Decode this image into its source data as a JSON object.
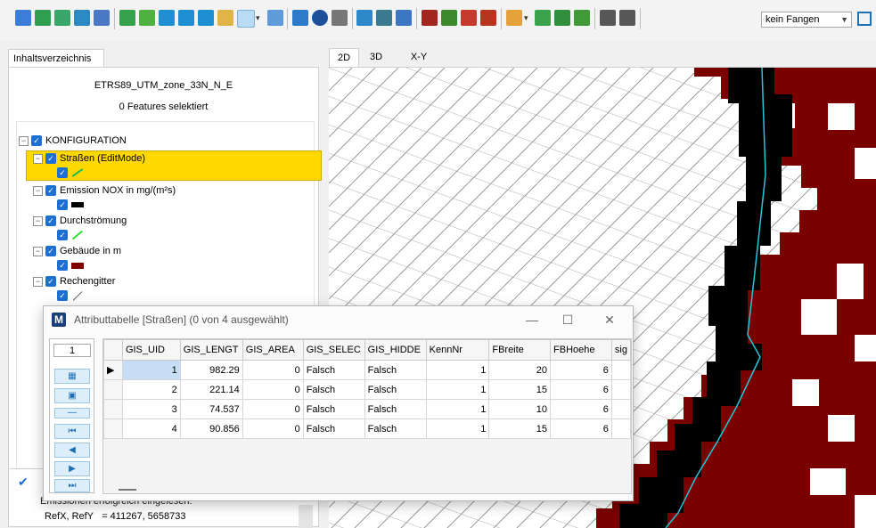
{
  "toolbar": {
    "snap_mode": "kein Fangen"
  },
  "left_panel": {
    "tab": "Inhaltsverzeichnis",
    "crs": "ETRS89_UTM_zone_33N_N_E",
    "selection": "0 Features selektiert",
    "tree": {
      "root": "KONFIGURATION",
      "layers": [
        {
          "label": "Straßen  (EditMode)",
          "swatch_color": "#1db954"
        },
        {
          "label": "Emission NOX in mg/(m²s)",
          "swatch_color": "#000000"
        },
        {
          "label": "Durchströmung",
          "swatch_color": "#2fdc2f"
        },
        {
          "label": "Gebäude in m",
          "swatch_color": "#800000"
        },
        {
          "label": "Rechengitter",
          "swatch_color": "#555555"
        }
      ]
    },
    "messages": {
      "line1": "Emissionen erfolgreich eingelesen.",
      "line2_label": "RefX, RefY",
      "line2_value": "= 411267, 5658733"
    }
  },
  "views": {
    "tabs": [
      "2D",
      "3D",
      "X-Y"
    ],
    "active": "2D"
  },
  "attribute_window": {
    "title": "Attributtabelle [Straßen] (0 von 4 ausgewählt)",
    "record": "1",
    "columns": [
      "GIS_UID",
      "GIS_LENGT",
      "GIS_AREA",
      "GIS_SELEC",
      "GIS_HIDDE",
      "KennNr",
      "FBreite",
      "FBHoehe",
      "sig"
    ],
    "rows": [
      [
        "1",
        "982.29",
        "0",
        "Falsch",
        "Falsch",
        "1",
        "20",
        "6",
        ""
      ],
      [
        "2",
        "221.14",
        "0",
        "Falsch",
        "Falsch",
        "1",
        "15",
        "6",
        ""
      ],
      [
        "3",
        "74.537",
        "0",
        "Falsch",
        "Falsch",
        "1",
        "10",
        "6",
        ""
      ],
      [
        "4",
        "90.856",
        "0",
        "Falsch",
        "Falsch",
        "1",
        "15",
        "6",
        ""
      ]
    ]
  },
  "colors": {
    "building": "#7a0000",
    "road": "#000000",
    "streamline": "#25c8d8",
    "highlight": "#ffd800"
  }
}
